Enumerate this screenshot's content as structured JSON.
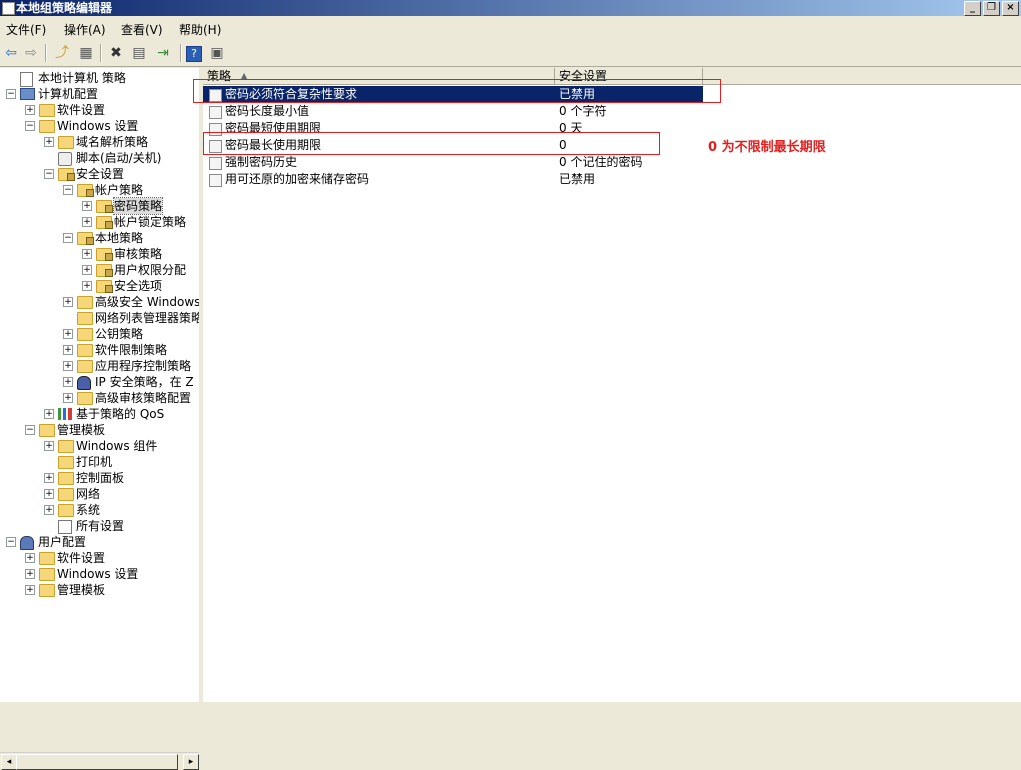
{
  "window": {
    "title": "本地组策略编辑器",
    "btn_min": "_",
    "btn_restore": "❐",
    "btn_close": "×"
  },
  "menu": [
    "文件(F)",
    "操作(A)",
    "查看(V)",
    "帮助(H)"
  ],
  "toolbar": {
    "back": "⇦",
    "forward": "⇨",
    "up": "⤴",
    "view": "▦",
    "delete": "✖",
    "props": "▤",
    "export": "⇥",
    "help": "?",
    "console": "▣"
  },
  "tree": [
    {
      "label": "本地计算机 策略"
    },
    {
      "label": "计算机配置"
    },
    {
      "label": "软件设置"
    },
    {
      "label": "Windows 设置"
    },
    {
      "label": "域名解析策略"
    },
    {
      "label": "脚本(启动/关机)"
    },
    {
      "label": "安全设置"
    },
    {
      "label": "帐户策略"
    },
    {
      "label": "密码策略"
    },
    {
      "label": "帐户锁定策略"
    },
    {
      "label": "本地策略"
    },
    {
      "label": "审核策略"
    },
    {
      "label": "用户权限分配"
    },
    {
      "label": "安全选项"
    },
    {
      "label": "高级安全 Windows"
    },
    {
      "label": "网络列表管理器策略"
    },
    {
      "label": "公钥策略"
    },
    {
      "label": "软件限制策略"
    },
    {
      "label": "应用程序控制策略"
    },
    {
      "label": "IP 安全策略，在 Z"
    },
    {
      "label": "高级审核策略配置"
    },
    {
      "label": "基于策略的 QoS"
    },
    {
      "label": "管理模板"
    },
    {
      "label": "Windows 组件"
    },
    {
      "label": "打印机"
    },
    {
      "label": "控制面板"
    },
    {
      "label": "网络"
    },
    {
      "label": "系统"
    },
    {
      "label": "所有设置"
    },
    {
      "label": "用户配置"
    },
    {
      "label": "软件设置"
    },
    {
      "label": "Windows 设置"
    },
    {
      "label": "管理模板"
    }
  ],
  "scroll": {
    "left": "◂",
    "right": "▸"
  },
  "list": {
    "columns": [
      "策略",
      "安全设置"
    ],
    "rows": [
      {
        "policy": "密码必须符合复杂性要求",
        "setting": "已禁用"
      },
      {
        "policy": "密码长度最小值",
        "setting": "0 个字符"
      },
      {
        "policy": "密码最短使用期限",
        "setting": "0 天"
      },
      {
        "policy": "密码最长使用期限",
        "setting": "0"
      },
      {
        "policy": "强制密码历史",
        "setting": "0 个记住的密码"
      },
      {
        "policy": "用可还原的加密来储存密码",
        "setting": "已禁用"
      }
    ]
  },
  "annotation": {
    "text": "0 为不限制最长期限",
    "color": "#e02020"
  }
}
